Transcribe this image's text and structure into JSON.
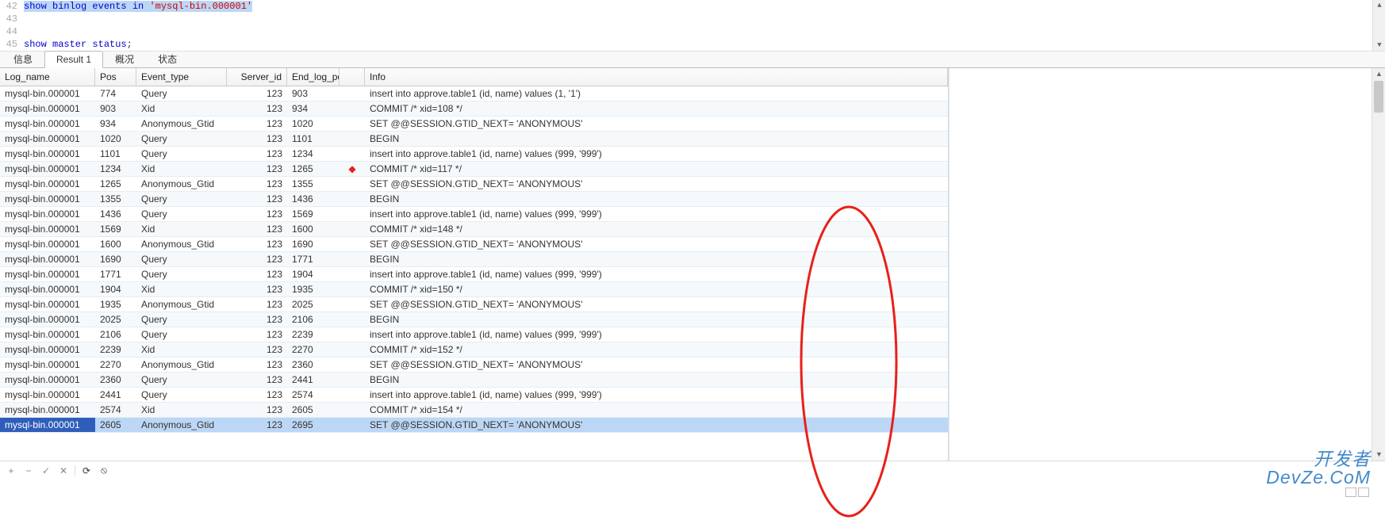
{
  "editor": {
    "lines": [
      {
        "num": "42",
        "parts": [
          {
            "t": "show binlog events ",
            "c": "kw sel"
          },
          {
            "t": "in",
            "c": "kw sel"
          },
          {
            "t": " ",
            "c": "sel"
          },
          {
            "t": "'mysql-bin.000001'",
            "c": "str sel"
          }
        ]
      },
      {
        "num": "43",
        "parts": []
      },
      {
        "num": "44",
        "parts": []
      },
      {
        "num": "45",
        "parts": [
          {
            "t": "show master status",
            "c": "kw"
          },
          {
            "t": ";",
            "c": ""
          }
        ]
      }
    ]
  },
  "tabs": {
    "items": [
      "信息",
      "Result 1",
      "概况",
      "状态"
    ],
    "active": 1
  },
  "columns": [
    "Log_name",
    "Pos",
    "Event_type",
    "Server_id",
    "End_log_pos",
    "Info"
  ],
  "rows": [
    {
      "log": "mysql-bin.000001",
      "pos": "774",
      "evt": "Query",
      "sid": "123",
      "end": "903",
      "arrow": "",
      "info": "insert into approve.table1 (id, name) values (1, '1')"
    },
    {
      "log": "mysql-bin.000001",
      "pos": "903",
      "evt": "Xid",
      "sid": "123",
      "end": "934",
      "arrow": "",
      "info": "COMMIT /* xid=108 */"
    },
    {
      "log": "mysql-bin.000001",
      "pos": "934",
      "evt": "Anonymous_Gtid",
      "sid": "123",
      "end": "1020",
      "arrow": "",
      "info": "SET @@SESSION.GTID_NEXT= 'ANONYMOUS'"
    },
    {
      "log": "mysql-bin.000001",
      "pos": "1020",
      "evt": "Query",
      "sid": "123",
      "end": "1101",
      "arrow": "",
      "info": "BEGIN"
    },
    {
      "log": "mysql-bin.000001",
      "pos": "1101",
      "evt": "Query",
      "sid": "123",
      "end": "1234",
      "arrow": "",
      "info": "insert into approve.table1 (id, name) values (999, '999')"
    },
    {
      "log": "mysql-bin.000001",
      "pos": "1234",
      "evt": "Xid",
      "sid": "123",
      "end": "1265",
      "arrow": "◆",
      "info": "COMMIT /* xid=117 */"
    },
    {
      "log": "mysql-bin.000001",
      "pos": "1265",
      "evt": "Anonymous_Gtid",
      "sid": "123",
      "end": "1355",
      "arrow": "",
      "info": "SET @@SESSION.GTID_NEXT= 'ANONYMOUS'"
    },
    {
      "log": "mysql-bin.000001",
      "pos": "1355",
      "evt": "Query",
      "sid": "123",
      "end": "1436",
      "arrow": "",
      "info": "BEGIN"
    },
    {
      "log": "mysql-bin.000001",
      "pos": "1436",
      "evt": "Query",
      "sid": "123",
      "end": "1569",
      "arrow": "",
      "info": "insert into approve.table1 (id, name) values (999, '999')"
    },
    {
      "log": "mysql-bin.000001",
      "pos": "1569",
      "evt": "Xid",
      "sid": "123",
      "end": "1600",
      "arrow": "",
      "info": "COMMIT /* xid=148 */"
    },
    {
      "log": "mysql-bin.000001",
      "pos": "1600",
      "evt": "Anonymous_Gtid",
      "sid": "123",
      "end": "1690",
      "arrow": "",
      "info": "SET @@SESSION.GTID_NEXT= 'ANONYMOUS'"
    },
    {
      "log": "mysql-bin.000001",
      "pos": "1690",
      "evt": "Query",
      "sid": "123",
      "end": "1771",
      "arrow": "",
      "info": "BEGIN"
    },
    {
      "log": "mysql-bin.000001",
      "pos": "1771",
      "evt": "Query",
      "sid": "123",
      "end": "1904",
      "arrow": "",
      "info": "insert into approve.table1 (id, name) values (999, '999')"
    },
    {
      "log": "mysql-bin.000001",
      "pos": "1904",
      "evt": "Xid",
      "sid": "123",
      "end": "1935",
      "arrow": "",
      "info": "COMMIT /* xid=150 */"
    },
    {
      "log": "mysql-bin.000001",
      "pos": "1935",
      "evt": "Anonymous_Gtid",
      "sid": "123",
      "end": "2025",
      "arrow": "",
      "info": "SET @@SESSION.GTID_NEXT= 'ANONYMOUS'"
    },
    {
      "log": "mysql-bin.000001",
      "pos": "2025",
      "evt": "Query",
      "sid": "123",
      "end": "2106",
      "arrow": "",
      "info": "BEGIN"
    },
    {
      "log": "mysql-bin.000001",
      "pos": "2106",
      "evt": "Query",
      "sid": "123",
      "end": "2239",
      "arrow": "",
      "info": "insert into approve.table1 (id, name) values (999, '999')"
    },
    {
      "log": "mysql-bin.000001",
      "pos": "2239",
      "evt": "Xid",
      "sid": "123",
      "end": "2270",
      "arrow": "",
      "info": "COMMIT /* xid=152 */"
    },
    {
      "log": "mysql-bin.000001",
      "pos": "2270",
      "evt": "Anonymous_Gtid",
      "sid": "123",
      "end": "2360",
      "arrow": "",
      "info": "SET @@SESSION.GTID_NEXT= 'ANONYMOUS'"
    },
    {
      "log": "mysql-bin.000001",
      "pos": "2360",
      "evt": "Query",
      "sid": "123",
      "end": "2441",
      "arrow": "",
      "info": "BEGIN"
    },
    {
      "log": "mysql-bin.000001",
      "pos": "2441",
      "evt": "Query",
      "sid": "123",
      "end": "2574",
      "arrow": "",
      "info": "insert into approve.table1 (id, name) values (999, '999')"
    },
    {
      "log": "mysql-bin.000001",
      "pos": "2574",
      "evt": "Xid",
      "sid": "123",
      "end": "2605",
      "arrow": "",
      "info": "COMMIT /* xid=154 */"
    },
    {
      "log": "mysql-bin.000001",
      "pos": "2605",
      "evt": "Anonymous_Gtid",
      "sid": "123",
      "end": "2695",
      "arrow": "",
      "info": "SET @@SESSION.GTID_NEXT= 'ANONYMOUS'",
      "selected": true
    }
  ],
  "toolbar": {
    "add": "+",
    "del": "−",
    "ok": "✓",
    "cancel": "✕",
    "refresh": "⟳",
    "stop": "⦸"
  },
  "watermark": {
    "r1": "开发者",
    "r2": "DevZe.CoM"
  }
}
